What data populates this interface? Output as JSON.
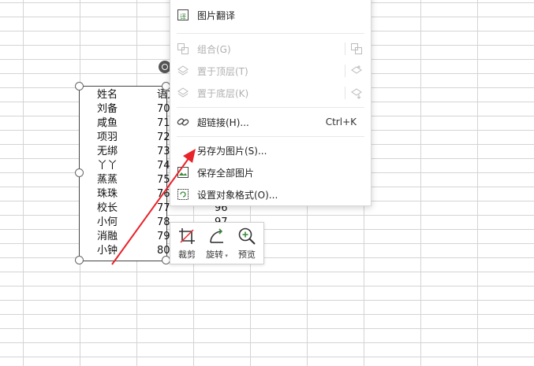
{
  "table": {
    "header": {
      "name": "姓名",
      "score": "语文"
    },
    "rows": [
      {
        "name": "刘备",
        "score": "70"
      },
      {
        "name": "咸鱼",
        "score": "71"
      },
      {
        "name": "项羽",
        "score": "72"
      },
      {
        "name": "无绑",
        "score": "73"
      },
      {
        "name": "丫丫",
        "score": "74"
      },
      {
        "name": "蒸蒸",
        "score": "75"
      },
      {
        "name": "珠珠",
        "score": "76"
      },
      {
        "name": "校长",
        "score": "77"
      },
      {
        "name": "小何",
        "score": "78"
      },
      {
        "name": "消融",
        "score": "79"
      },
      {
        "name": "小钟",
        "score": "80"
      }
    ],
    "right_values": [
      "96",
      "97"
    ]
  },
  "context_menu": {
    "picture_translate": "图片翻译",
    "group": "组合(G)",
    "bring_to_front": "置于顶层(T)",
    "send_to_back": "置于底层(K)",
    "hyperlink": "超链接(H)...",
    "hyperlink_shortcut": "Ctrl+K",
    "save_as_picture": "另存为图片(S)...",
    "save_all_pictures": "保存全部图片",
    "format_object": "设置对象格式(O)..."
  },
  "mini_toolbar": {
    "crop": "裁剪",
    "rotate": "旋转",
    "preview": "预览"
  },
  "colors": {
    "arrow": "#e8232a",
    "grid": "#d4d4d4",
    "disabled_text": "#b0b0b0"
  }
}
